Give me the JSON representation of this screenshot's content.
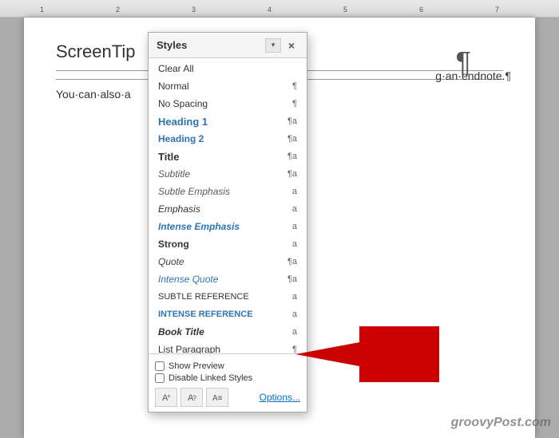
{
  "panel": {
    "title": "Styles",
    "close_label": "×",
    "dropdown_icon": "▾"
  },
  "styles_list": [
    {
      "name": "Clear All",
      "icon": "",
      "type": "clear"
    },
    {
      "name": "Normal",
      "icon": "¶",
      "type": "para"
    },
    {
      "name": "No Spacing",
      "icon": "¶",
      "type": "para"
    },
    {
      "name": "Heading 1",
      "icon": "¶a",
      "type": "linked"
    },
    {
      "name": "Heading 2",
      "icon": "¶a",
      "type": "linked"
    },
    {
      "name": "Title",
      "icon": "¶a",
      "type": "linked"
    },
    {
      "name": "Subtitle",
      "icon": "¶a",
      "type": "linked"
    },
    {
      "name": "Subtle Emphasis",
      "icon": "a",
      "type": "char"
    },
    {
      "name": "Emphasis",
      "icon": "a",
      "type": "char"
    },
    {
      "name": "Intense Emphasis",
      "icon": "a",
      "type": "char"
    },
    {
      "name": "Strong",
      "icon": "a",
      "type": "char"
    },
    {
      "name": "Quote",
      "icon": "¶a",
      "type": "linked"
    },
    {
      "name": "Intense Quote",
      "icon": "¶a",
      "type": "linked"
    },
    {
      "name": "Subtle Reference",
      "icon": "a",
      "type": "char"
    },
    {
      "name": "Intense Reference",
      "icon": "a",
      "type": "char"
    },
    {
      "name": "Book Title",
      "icon": "a",
      "type": "char"
    },
    {
      "name": "List Paragraph",
      "icon": "¶",
      "type": "para"
    }
  ],
  "footer": {
    "show_preview_label": "Show Preview",
    "disable_linked_label": "Disable Linked Styles",
    "options_label": "Options..."
  },
  "doc": {
    "screentip": "ScreenTip",
    "body_text": "You·can·also·a",
    "endnote_text": "g·an·endnote.¶",
    "pilcrow": "¶"
  },
  "watermark": "groovyPost.com"
}
